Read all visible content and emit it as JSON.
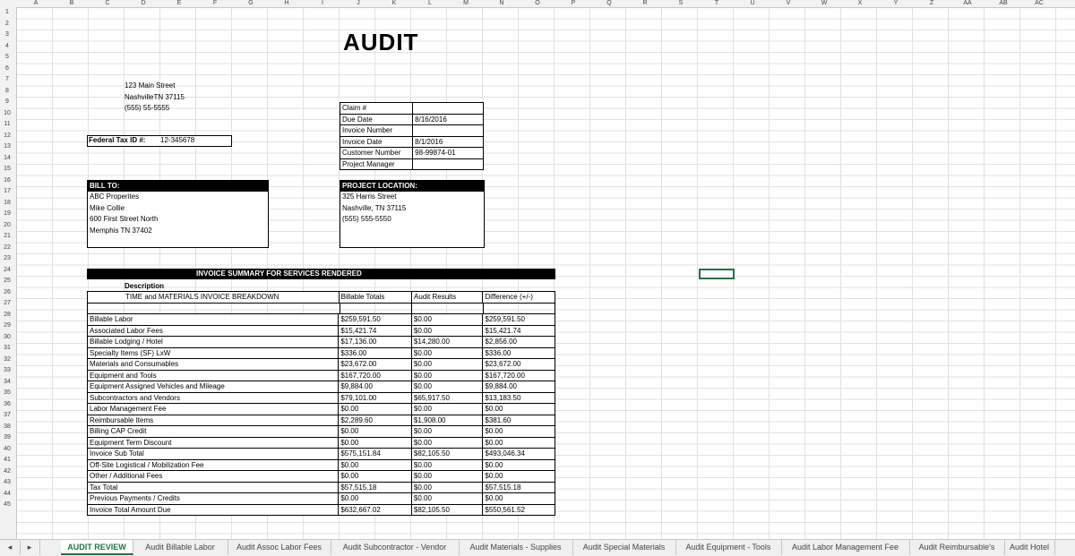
{
  "columns": [
    "A",
    "B",
    "C",
    "D",
    "E",
    "F",
    "G",
    "H",
    "I",
    "J",
    "K",
    "L",
    "M",
    "N",
    "O",
    "P",
    "Q",
    "R",
    "S",
    "T",
    "U",
    "V",
    "W",
    "X",
    "Y",
    "Z",
    "AA",
    "AB",
    "AC"
  ],
  "rows": [
    "1",
    "2",
    "3",
    "4",
    "5",
    "6",
    "7",
    "8",
    "9",
    "10",
    "11",
    "12",
    "13",
    "14",
    "15",
    "16",
    "17",
    "18",
    "19",
    "20",
    "21",
    "22",
    "23",
    "24",
    "25",
    "26",
    "27",
    "28",
    "29",
    "30",
    "31",
    "32",
    "33",
    "34",
    "35",
    "36",
    "37",
    "38",
    "39",
    "40",
    "41",
    "42",
    "43",
    "44",
    "45"
  ],
  "title": "AUDIT",
  "company": {
    "street": "123 Main Street",
    "city": "NashvilleTN 37115",
    "phone": "(555) 55-5555"
  },
  "tax": {
    "label": "Federal Tax ID #:",
    "value": "12-345678"
  },
  "claim_fields": [
    {
      "label": "Claim #",
      "value": ""
    },
    {
      "label": "Due Date",
      "value": "8/16/2016"
    },
    {
      "label": "Invoice Number",
      "value": ""
    },
    {
      "label": "Invoice Date",
      "value": "8/1/2016"
    },
    {
      "label": "Customer Number",
      "value": "98-99874-01"
    },
    {
      "label": "Project Manager",
      "value": ""
    }
  ],
  "bill_to": {
    "header": "BILL TO:",
    "lines": [
      "ABC Properites",
      "Mike Collie",
      "600 First Street North",
      "Memphis TN 37402"
    ]
  },
  "project_location": {
    "header": "PROJECT LOCATION:",
    "lines": [
      "325 Harris Street",
      "Nashville, TN 37115",
      "(555) 555-5550"
    ]
  },
  "summary": {
    "header": "INVOICE SUMMARY FOR SERVICES RENDERED",
    "description_label": "Description",
    "breakdown_label": "TIME and MATERIALS INVOICE BREAKDOWN",
    "col_billable": "Billable Totals",
    "col_audit": "Audit Results",
    "col_diff": "Difference (+/-)",
    "items": [
      {
        "desc": "Billable Labor",
        "billable": "$259,591.50",
        "audit": "$0.00",
        "diff": "$259,591.50"
      },
      {
        "desc": "Associated Labor Fees",
        "billable": "$15,421.74",
        "audit": "$0.00",
        "diff": "$15,421.74"
      },
      {
        "desc": "Billable Lodging / Hotel",
        "billable": "$17,136.00",
        "audit": "$14,280.00",
        "diff": "$2,856.00"
      },
      {
        "desc": "Specialty Items (SF) LxW",
        "billable": "$336.00",
        "audit": "$0.00",
        "diff": "$336.00"
      },
      {
        "desc": "Materials and Consumables",
        "billable": "$23,672.00",
        "audit": "$0.00",
        "diff": "$23,672.00"
      },
      {
        "desc": "Equipment and Tools",
        "billable": "$167,720.00",
        "audit": "$0.00",
        "diff": "$167,720.00"
      },
      {
        "desc": "Equipment Assigned Vehicles and Mileage",
        "billable": "$9,884.00",
        "audit": "$0.00",
        "diff": "$9,884.00"
      },
      {
        "desc": "Subcontractors and Vendors",
        "billable": "$79,101.00",
        "audit": "$65,917.50",
        "diff": "$13,183.50"
      },
      {
        "desc": "Labor Management Fee",
        "billable": "$0.00",
        "audit": "$0.00",
        "diff": "$0.00"
      },
      {
        "desc": "Reimbursable Items",
        "billable": "$2,289.60",
        "audit": "$1,908.00",
        "diff": "$381.60"
      },
      {
        "desc": "Billing CAP Credit",
        "billable": "$0.00",
        "audit": "$0.00",
        "diff": "$0.00"
      },
      {
        "desc": "Equipment Term Discount",
        "billable": "$0.00",
        "audit": "$0.00",
        "diff": "$0.00"
      },
      {
        "desc": "Invoice Sub Total",
        "billable": "$575,151.84",
        "audit": "$82,105.50",
        "diff": "$493,046.34"
      },
      {
        "desc": "Off-Site Logistical / Mobilization Fee",
        "billable": "$0.00",
        "audit": "$0.00",
        "diff": "$0.00"
      },
      {
        "desc": "Other / Additional Fees",
        "billable": "$0.00",
        "audit": "$0.00",
        "diff": "$0.00"
      },
      {
        "desc": "Tax Total",
        "billable": "$57,515.18",
        "audit": "$0.00",
        "diff": "$57,515.18"
      },
      {
        "desc": "Previous Payments / Credits",
        "billable": "$0.00",
        "audit": "$0.00",
        "diff": "$0.00"
      },
      {
        "desc": "Invoice Total Amount Due",
        "billable": "$632,667.02",
        "audit": "$82,105.50",
        "diff": "$550,561.52"
      }
    ]
  },
  "sheet_tabs": [
    "AUDIT REVIEW",
    "Audit Billable Labor",
    "Audit Assoc Labor Fees",
    "Audit Subcontractor - Vendor",
    "Audit Materials - Supplies",
    "Audit Special Materials",
    "Audit Equipment - Tools",
    "Audit Labor Management Fee",
    "Audit Reimbursable's",
    "Audit Hotel"
  ],
  "active_tab": "AUDIT REVIEW",
  "accent_color": "#217346"
}
